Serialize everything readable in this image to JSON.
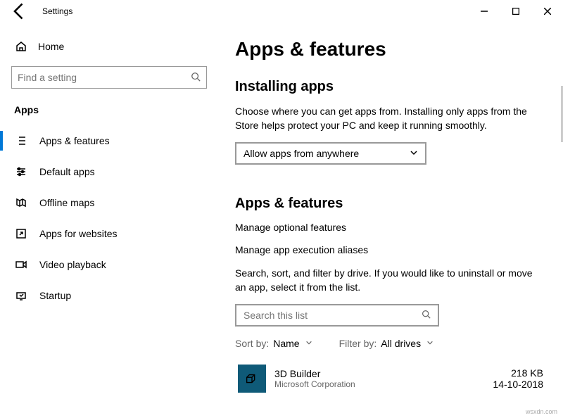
{
  "titlebar": {
    "title": "Settings"
  },
  "sidebar": {
    "home": "Home",
    "search_placeholder": "Find a setting",
    "category": "Apps",
    "items": [
      {
        "label": "Apps & features"
      },
      {
        "label": "Default apps"
      },
      {
        "label": "Offline maps"
      },
      {
        "label": "Apps for websites"
      },
      {
        "label": "Video playback"
      },
      {
        "label": "Startup"
      }
    ]
  },
  "main": {
    "heading": "Apps & features",
    "installing": {
      "title": "Installing apps",
      "desc": "Choose where you can get apps from. Installing only apps from the Store helps protect your PC and keep it running smoothly.",
      "dropdown": "Allow apps from anywhere"
    },
    "features": {
      "title": "Apps & features",
      "link1": "Manage optional features",
      "link2": "Manage app execution aliases",
      "desc": "Search, sort, and filter by drive. If you would like to uninstall or move an app, select it from the list.",
      "search_placeholder": "Search this list",
      "sort_label": "Sort by:",
      "sort_value": "Name",
      "filter_label": "Filter by:",
      "filter_value": "All drives"
    },
    "app": {
      "name": "3D Builder",
      "publisher": "Microsoft Corporation",
      "size": "218 KB",
      "date": "14-10-2018"
    }
  },
  "watermark": "wsxdn.com"
}
